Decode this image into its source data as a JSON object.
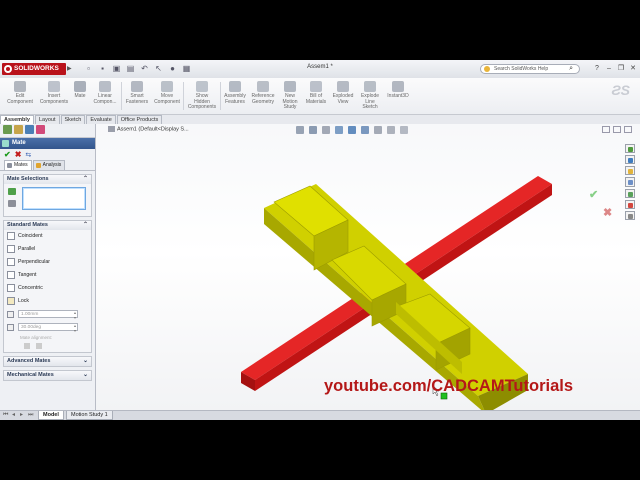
{
  "app": {
    "brand": "SOLIDWORKS",
    "doc_title": "Assem1 *",
    "search_placeholder": "Search SolidWorks Help"
  },
  "command_manager": [
    {
      "label": "Edit\nComponent",
      "icon": "edit-component-icon"
    },
    {
      "label": "Insert\nComponents",
      "icon": "insert-components-icon"
    },
    {
      "label": "Mate",
      "icon": "mate-icon"
    },
    {
      "label": "Linear\nCompon...",
      "icon": "linear-pattern-icon"
    },
    {
      "label": "Smart\nFasteners",
      "icon": "smart-fasteners-icon"
    },
    {
      "label": "Move\nComponent",
      "icon": "move-component-icon"
    },
    {
      "label": "Show\nHidden\nComponents",
      "icon": "show-hidden-icon"
    },
    {
      "label": "Assembly\nFeatures",
      "icon": "assembly-features-icon"
    },
    {
      "label": "Reference\nGeometry",
      "icon": "reference-geometry-icon"
    },
    {
      "label": "New\nMotion\nStudy",
      "icon": "motion-study-icon"
    },
    {
      "label": "Bill of\nMaterials",
      "icon": "bom-icon"
    },
    {
      "label": "Exploded\nView",
      "icon": "exploded-view-icon"
    },
    {
      "label": "Explode\nLine\nSketch",
      "icon": "explode-line-icon"
    },
    {
      "label": "Instant3D",
      "icon": "instant3d-icon"
    }
  ],
  "tabs": [
    "Assembly",
    "Layout",
    "Sketch",
    "Evaluate",
    "Office Products"
  ],
  "property_manager": {
    "title": "Mate",
    "subtabs": [
      "Mates",
      "Analysis"
    ],
    "mate_selections_label": "Mate Selections",
    "standard_mates_label": "Standard Mates",
    "standard_mates": [
      "Coincident",
      "Parallel",
      "Perpendicular",
      "Tangent",
      "Concentric",
      "Lock"
    ],
    "distance_value": "1.00mm",
    "angle_value": "30.00deg",
    "mate_alignment_label": "Mate alignment:",
    "advanced_label": "Advanced Mates",
    "mechanical_label": "Mechanical Mates"
  },
  "viewport": {
    "tree_root": "Assem1  (Default<Display S..."
  },
  "overlay": {
    "watermark": "youtube.com/CADCAMTutorials"
  },
  "bottom_tabs": [
    "Model",
    "Motion Study 1"
  ],
  "colors": {
    "brand_red": "#b9121b",
    "bar_red": "#d81c1c",
    "block_yellow": "#c8c800",
    "watermark_red": "#b41818"
  }
}
